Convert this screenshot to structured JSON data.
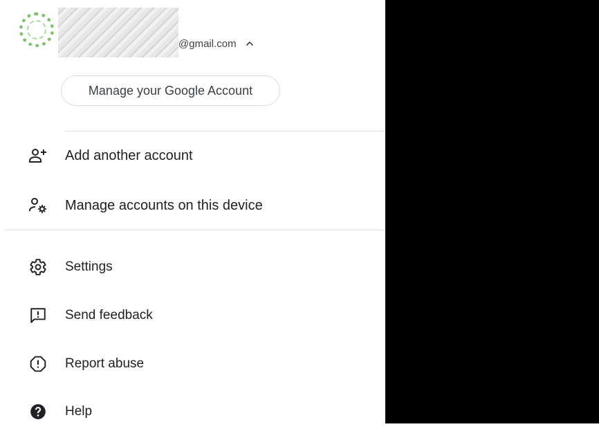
{
  "account": {
    "email_suffix": "@gmail.com",
    "manage_button": "Manage your Google Account"
  },
  "menu": {
    "add_account": "Add another account",
    "manage_device": "Manage accounts on this device",
    "settings": "Settings",
    "feedback": "Send feedback",
    "report": "Report abuse",
    "help": "Help"
  },
  "icons": {
    "add": "person-add-icon",
    "manage": "manage-accounts-icon",
    "settings": "gear-icon",
    "feedback": "feedback-icon",
    "report": "report-icon",
    "help": "help-icon"
  },
  "colors": {
    "text": "#202124",
    "divider": "#e0e0e0",
    "avatar_ring": "#7cc36a"
  }
}
